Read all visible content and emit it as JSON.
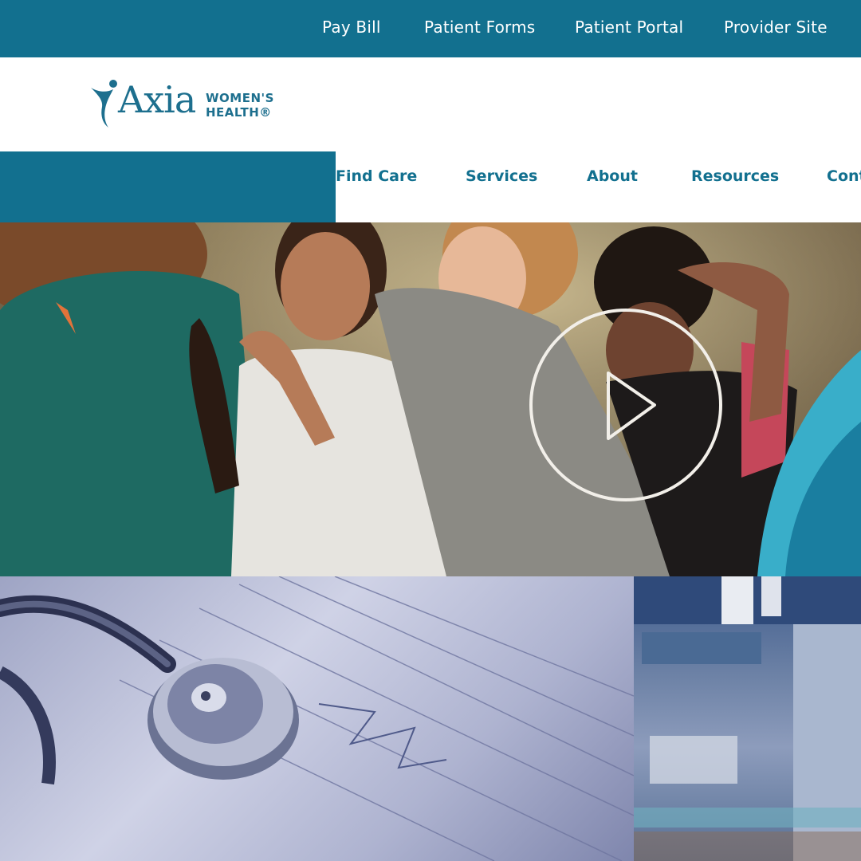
{
  "utility_nav": {
    "pay_bill": "Pay Bill",
    "patient_forms": "Patient Forms",
    "patient_portal": "Patient Portal",
    "provider_site": "Provider Site"
  },
  "brand": {
    "name": "Axia",
    "tagline_line1": "WOMEN'S",
    "tagline_line2": "HEALTH®"
  },
  "main_nav": {
    "find_care": "Find Care",
    "services": "Services",
    "about": "About",
    "resources": "Resources",
    "contact": "Cont"
  },
  "colors": {
    "brand_teal": "#12708f",
    "wave_light": "#39aec9",
    "wave_dark": "#1a7ea0"
  },
  "icons": {
    "hero_play": "play-icon",
    "logo_figure": "dancer-icon"
  }
}
